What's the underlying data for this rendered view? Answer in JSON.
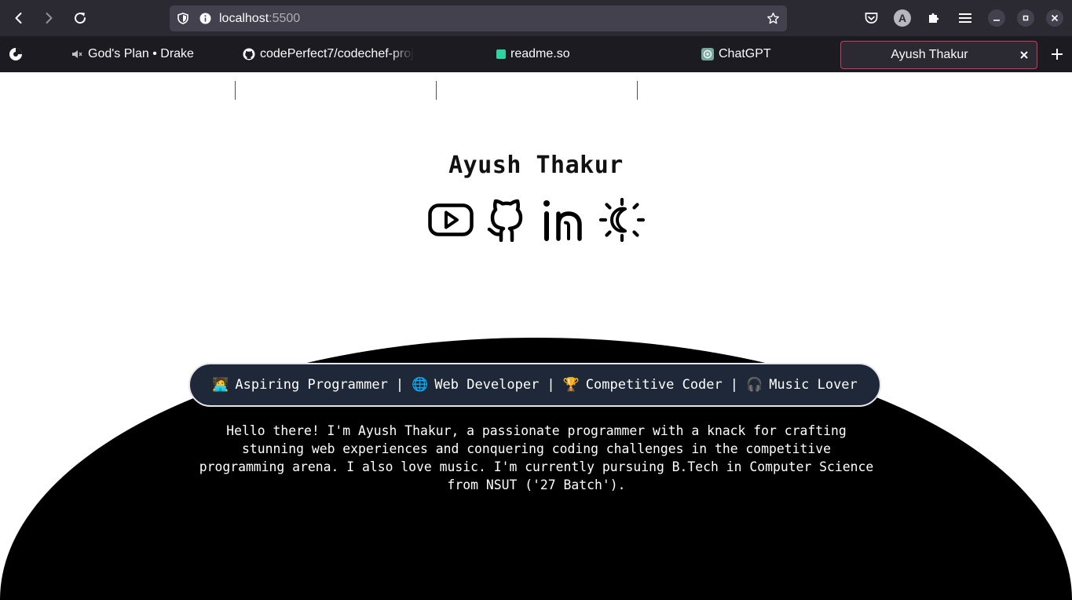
{
  "browser": {
    "url_host": "localhost",
    "url_port": ":5500",
    "tabs": [
      {
        "label": "God's Plan • Drake",
        "icon": "speaker-icon"
      },
      {
        "label": "codePerfect7/codechef-proj",
        "icon": "github-icon"
      },
      {
        "label": "readme.so",
        "icon": "readme-icon"
      },
      {
        "label": "ChatGPT",
        "icon": "chatgpt-icon"
      },
      {
        "label": "Ayush Thakur",
        "icon": "none",
        "active": true
      }
    ],
    "profile_initial": "A",
    "accent_color": "#cf3a5a"
  },
  "page": {
    "name": "Ayush Thakur",
    "socials": [
      "youtube-icon",
      "github-icon",
      "linkedin-icon",
      "theme-toggle-icon"
    ],
    "tagline": [
      {
        "emoji": "🧑‍💻",
        "text": "Aspiring Programmer"
      },
      {
        "emoji": "🌐",
        "text": "Web Developer"
      },
      {
        "emoji": "🏆",
        "text": "Competitive Coder"
      },
      {
        "emoji": "🎧",
        "text": "Music Lover"
      }
    ],
    "tagline_separator": "|",
    "bio": "Hello there! I'm Ayush Thakur, a passionate programmer with a knack for crafting stunning web experiences and conquering coding challenges in the competitive programming arena. I also love music. I'm currently pursuing B.Tech in Computer Science from NSUT ('27 Batch')."
  }
}
